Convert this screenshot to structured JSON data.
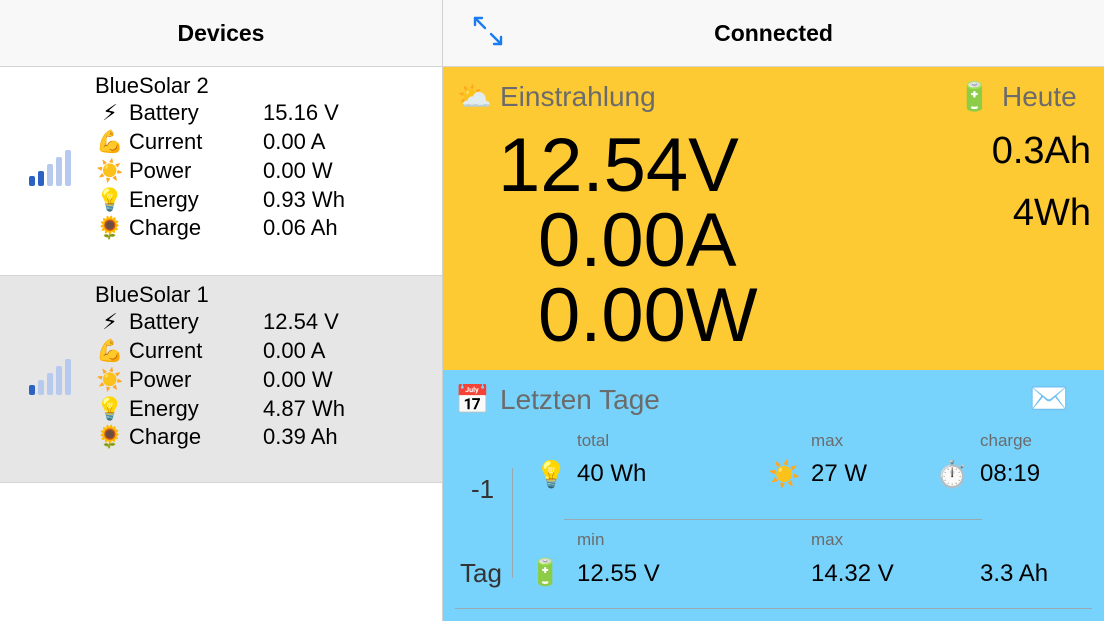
{
  "left": {
    "title": "Devices",
    "devices": [
      {
        "name": "BlueSolar 2",
        "rows": [
          {
            "icon": "⚡",
            "label": "Battery",
            "value": "15.16 V"
          },
          {
            "icon": "💪",
            "label": "Current",
            "value": "0.00 A"
          },
          {
            "icon": "☀️",
            "label": "Power",
            "value": "0.00 W"
          },
          {
            "icon": "💡",
            "label": "Energy",
            "value": "0.93 Wh"
          },
          {
            "icon": "🌻",
            "label": "Charge",
            "value": "0.06 Ah"
          }
        ]
      },
      {
        "name": "BlueSolar 1",
        "rows": [
          {
            "icon": "⚡",
            "label": "Battery",
            "value": "12.54 V"
          },
          {
            "icon": "💪",
            "label": "Current",
            "value": "0.00 A"
          },
          {
            "icon": "☀️",
            "label": "Power",
            "value": "0.00 W"
          },
          {
            "icon": "💡",
            "label": "Energy",
            "value": "4.87 Wh"
          },
          {
            "icon": "🌻",
            "label": "Charge",
            "value": "0.39 Ah"
          }
        ]
      }
    ]
  },
  "right": {
    "title": "Connected",
    "live": {
      "header": "Einstrahlung",
      "header_icon": "⛅",
      "voltage": "12.54V",
      "current": "0.00A",
      "power": "0.00W"
    },
    "today": {
      "header": "Heute",
      "header_icon": "🔋",
      "ah": "0.3Ah",
      "wh": "4Wh"
    },
    "history": {
      "header": "Letzten Tage",
      "calendar_icon": "📅",
      "mail_icon": "✉️",
      "day_offset": "-1",
      "day_label": "Tag",
      "row1": {
        "col1": {
          "label": "total",
          "icon": "💡",
          "value": "40 Wh"
        },
        "col2": {
          "label": "max",
          "icon": "☀️",
          "value": "27 W"
        },
        "col3": {
          "label": "charge",
          "icon": "⏱️",
          "value": "08:19"
        }
      },
      "row2": {
        "icon": "🔋",
        "col1": {
          "label": "min",
          "value": "12.55 V"
        },
        "col2": {
          "label": "max",
          "value": "14.32 V"
        },
        "col3": {
          "value": "3.3 Ah"
        }
      }
    }
  },
  "colors": {
    "accent": "#1a7cf2",
    "live_panel": "#fdca34",
    "history_panel": "#78d3fc",
    "selected_row": "#e6e6e6",
    "signal_active": "#2c62c4",
    "signal_inactive": "#b8c9ee"
  }
}
